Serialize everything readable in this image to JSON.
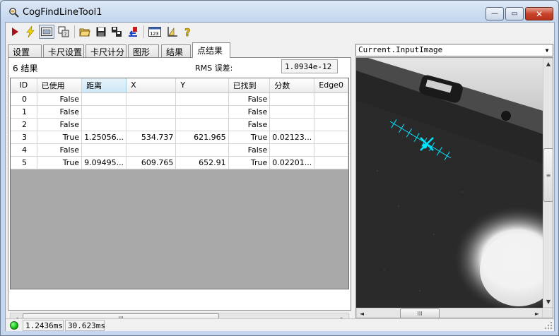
{
  "window": {
    "title": "CogFindLineTool1",
    "minimize_glyph": "—",
    "maximize_glyph": "▭",
    "close_glyph": "✕"
  },
  "toolbar": {
    "icons": [
      "run-icon",
      "electric-mode-icon",
      "image-view-icon",
      "local-graphics-icon",
      "open-folder-icon",
      "save-icon",
      "save-as-icon",
      "reset-icon",
      "input-image-icon",
      "measure-icon",
      "help-icon"
    ]
  },
  "tabs": [
    {
      "label": "设置"
    },
    {
      "label": "卡尺设置"
    },
    {
      "label": "卡尺计分"
    },
    {
      "label": "图形"
    },
    {
      "label": "结果"
    },
    {
      "label": "点结果"
    }
  ],
  "results": {
    "count_text": "6 结果",
    "rms_label": "RMS 误差:",
    "rms_value": "1.0934e-12"
  },
  "table": {
    "columns": [
      "ID",
      "已使用",
      "距离",
      "X",
      "Y",
      "已找到",
      "分数",
      "Edge0"
    ],
    "rows": [
      [
        "0",
        "False",
        "",
        "",
        "",
        "False",
        "",
        ""
      ],
      [
        "1",
        "False",
        "",
        "",
        "",
        "False",
        "",
        ""
      ],
      [
        "2",
        "False",
        "",
        "",
        "",
        "False",
        "",
        ""
      ],
      [
        "3",
        "True",
        "1.25056...",
        "534.737",
        "621.965",
        "True",
        "0.02123...",
        ""
      ],
      [
        "4",
        "False",
        "",
        "",
        "",
        "False",
        "",
        ""
      ],
      [
        "5",
        "True",
        "9.09495...",
        "609.765",
        "652.91",
        "True",
        "0.02201...",
        ""
      ]
    ]
  },
  "scrollbar": {
    "thumb_glyph": "III",
    "left_arrow": "◄",
    "right_arrow": "►",
    "up_arrow": "▲",
    "down_arrow": "▼"
  },
  "image_panel": {
    "selected_image": "Current.InputImage",
    "graphics_color": "#00e5ff"
  },
  "status": {
    "led_color": "#12c412",
    "time1": "1.2436ms",
    "time2": "30.623ms"
  }
}
